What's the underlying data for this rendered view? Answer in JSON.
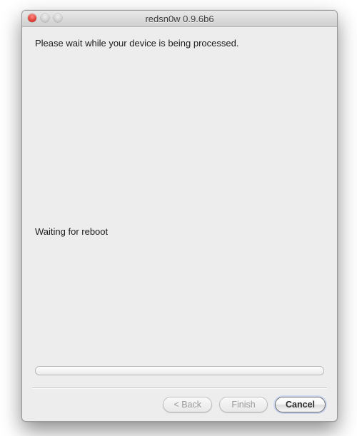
{
  "window": {
    "title": "redsn0w 0.9.6b6"
  },
  "content": {
    "message": "Please wait while your device is being processed.",
    "status": "Waiting for reboot"
  },
  "progress": {
    "percent": 0
  },
  "buttons": {
    "back": "< Back",
    "finish": "Finish",
    "cancel": "Cancel"
  }
}
